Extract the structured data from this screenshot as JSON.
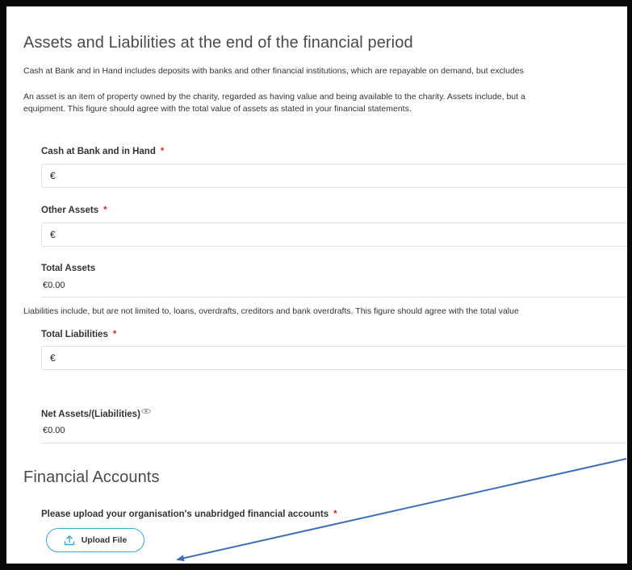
{
  "assets_section": {
    "title": "Assets and Liabilities at the end of the financial period",
    "cash_desc": "Cash at Bank and in Hand includes deposits with banks and other financial institutions, which are repayable on demand, but excludes",
    "asset_desc_line1": "An asset is an item of property owned by the charity, regarded as having value and being available to the charity. Assets include, but a",
    "asset_desc_line2": "equipment. This figure should agree with the total value of assets as stated in your financial statements."
  },
  "fields": {
    "cash": {
      "label": "Cash at Bank and in Hand",
      "required_mark": "*",
      "prefix": "€",
      "value": ""
    },
    "other_assets": {
      "label": "Other Assets",
      "required_mark": "*",
      "prefix": "€",
      "value": ""
    },
    "total_assets": {
      "label": "Total Assets",
      "value": "€0.00"
    },
    "liabilities_desc": "Liabilities include, but are not limited to, loans, overdrafts, creditors and bank overdrafts. This figure should agree with the total value",
    "total_liabilities": {
      "label": "Total Liabilities",
      "required_mark": "*",
      "prefix": "€",
      "value": ""
    },
    "net_assets": {
      "label": "Net Assets/(Liabilities)",
      "value": "€0.00"
    }
  },
  "financial_accounts": {
    "title": "Financial Accounts",
    "upload_label": "Please upload your organisation's unabridged financial accounts",
    "required_mark": "*",
    "upload_button": "Upload File"
  },
  "icons": {
    "eye": "eye-icon",
    "upload": "upload-icon"
  },
  "colors": {
    "required": "#e0252a",
    "button_border": "#37a8d6",
    "annotation_arrow": "#3f6fb3"
  }
}
